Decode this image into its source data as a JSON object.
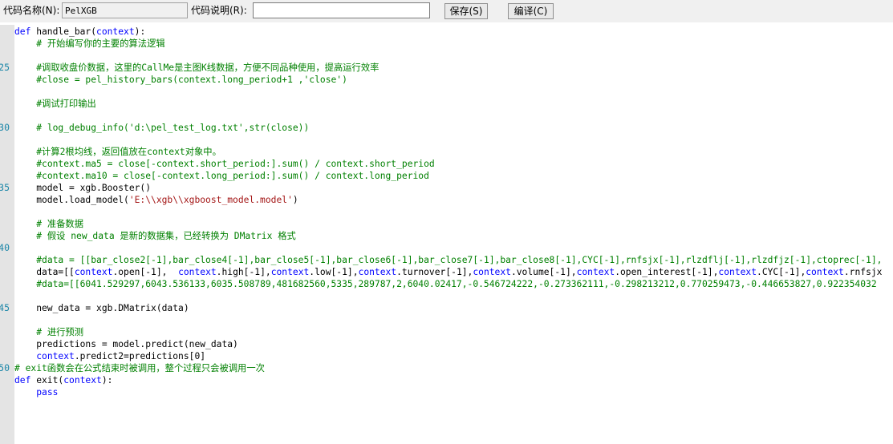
{
  "toolbar": {
    "name_label": "代码名称(N):",
    "name_value": "PelXGB",
    "desc_label": "代码说明(R):",
    "desc_value": "",
    "save_label": "保存(S)",
    "compile_label": "编译(C)"
  },
  "gutter": {
    "line_numbers": [
      {
        "row": 3,
        "text": "25"
      },
      {
        "row": 8,
        "text": "30"
      },
      {
        "row": 13,
        "text": "35"
      },
      {
        "row": 18,
        "text": "40"
      },
      {
        "row": 23,
        "text": "45"
      },
      {
        "row": 28,
        "text": "50"
      }
    ]
  },
  "code": {
    "lines": [
      [
        {
          "c": "kw",
          "t": "def"
        },
        {
          "c": "t",
          "t": " handle_bar("
        },
        {
          "c": "ctx",
          "t": "context"
        },
        {
          "c": "t",
          "t": "):"
        }
      ],
      [
        {
          "c": "t",
          "t": "    "
        },
        {
          "c": "cm",
          "t": "# 开始编写你的主要的算法逻辑"
        }
      ],
      [],
      [
        {
          "c": "t",
          "t": "    "
        },
        {
          "c": "cm",
          "t": "#调取收盘价数据，这里的CallMe是主图K线数据，方便不同品种使用，提高运行效率"
        }
      ],
      [
        {
          "c": "t",
          "t": "    "
        },
        {
          "c": "cm",
          "t": "#close = pel_history_bars(context.long_period+1 ,'close')"
        }
      ],
      [],
      [
        {
          "c": "t",
          "t": "    "
        },
        {
          "c": "cm",
          "t": "#调试打印输出"
        }
      ],
      [],
      [
        {
          "c": "t",
          "t": "    "
        },
        {
          "c": "cm",
          "t": "# log_debug_info('d:\\pel_test_log.txt',str(close))"
        }
      ],
      [],
      [
        {
          "c": "t",
          "t": "    "
        },
        {
          "c": "cm",
          "t": "#计算2根均线，返回值放在context对象中。"
        }
      ],
      [
        {
          "c": "t",
          "t": "    "
        },
        {
          "c": "cm",
          "t": "#context.ma5 = close[-context.short_period:].sum() / context.short_period"
        }
      ],
      [
        {
          "c": "t",
          "t": "    "
        },
        {
          "c": "cm",
          "t": "#context.ma10 = close[-context.long_period:].sum() / context.long_period"
        }
      ],
      [
        {
          "c": "t",
          "t": "    model = xgb.Booster()"
        }
      ],
      [
        {
          "c": "t",
          "t": "    model.load_model("
        },
        {
          "c": "st",
          "t": "'E:\\\\xgb\\\\xgboost_model.model'"
        },
        {
          "c": "t",
          "t": ")"
        }
      ],
      [],
      [
        {
          "c": "t",
          "t": "    "
        },
        {
          "c": "cm",
          "t": "# 准备数据"
        }
      ],
      [
        {
          "c": "t",
          "t": "    "
        },
        {
          "c": "cm",
          "t": "# 假设 new_data 是新的数据集，已经转换为 DMatrix 格式"
        }
      ],
      [],
      [
        {
          "c": "t",
          "t": "    "
        },
        {
          "c": "cm",
          "t": "#data = [[bar_close2[-1],bar_close4[-1],bar_close5[-1],bar_close6[-1],bar_close7[-1],bar_close8[-1],CYC[-1],rnfsjx[-1],rlzdflj[-1],rlzdfjz[-1],ctoprec[-1],"
        }
      ],
      [
        {
          "c": "t",
          "t": "    data=[["
        },
        {
          "c": "ctx",
          "t": "context"
        },
        {
          "c": "t",
          "t": ".open[-1],  "
        },
        {
          "c": "ctx",
          "t": "context"
        },
        {
          "c": "t",
          "t": ".high[-1],"
        },
        {
          "c": "ctx",
          "t": "context"
        },
        {
          "c": "t",
          "t": ".low[-1],"
        },
        {
          "c": "ctx",
          "t": "context"
        },
        {
          "c": "t",
          "t": ".turnover[-1],"
        },
        {
          "c": "ctx",
          "t": "context"
        },
        {
          "c": "t",
          "t": ".volume[-1],"
        },
        {
          "c": "ctx",
          "t": "context"
        },
        {
          "c": "t",
          "t": ".open_interest[-1],"
        },
        {
          "c": "ctx",
          "t": "context"
        },
        {
          "c": "t",
          "t": ".CYC[-1],"
        },
        {
          "c": "ctx",
          "t": "context"
        },
        {
          "c": "t",
          "t": ".rnfsjx"
        }
      ],
      [
        {
          "c": "t",
          "t": "    "
        },
        {
          "c": "cm",
          "t": "#data=[[6041.529297,6043.536133,6035.508789,481682560,5335,289787,2,6040.02417,-0.546724222,-0.273362111,-0.298213212,0.770259473,-0.446653827,0.922354032"
        }
      ],
      [],
      [
        {
          "c": "t",
          "t": "    new_data = xgb.DMatrix(data)"
        }
      ],
      [],
      [
        {
          "c": "t",
          "t": "    "
        },
        {
          "c": "cm",
          "t": "# 进行预测"
        }
      ],
      [
        {
          "c": "t",
          "t": "    predictions = model.predict(new_data)"
        }
      ],
      [
        {
          "c": "t",
          "t": "    "
        },
        {
          "c": "ctx",
          "t": "context"
        },
        {
          "c": "t",
          "t": ".predict2=predictions[0]"
        }
      ],
      [
        {
          "c": "cm",
          "t": "# exit函数会在公式结束时被调用，整个过程只会被调用一次"
        }
      ],
      [
        {
          "c": "kw",
          "t": "def"
        },
        {
          "c": "t",
          "t": " exit("
        },
        {
          "c": "ctx",
          "t": "context"
        },
        {
          "c": "t",
          "t": "):"
        }
      ],
      [
        {
          "c": "t",
          "t": "    "
        },
        {
          "c": "kw",
          "t": "pass"
        }
      ]
    ]
  }
}
